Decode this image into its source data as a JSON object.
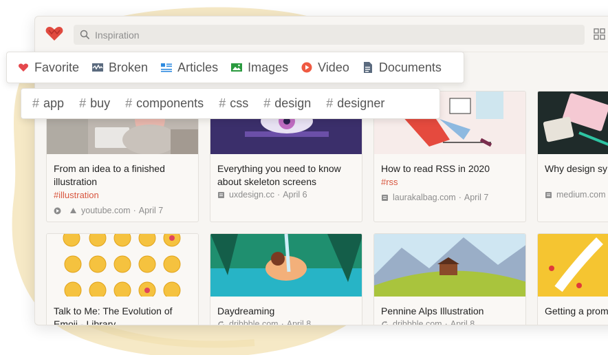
{
  "search": {
    "placeholder": "Inspiration",
    "value": ""
  },
  "types": [
    {
      "label": "Favorite",
      "icon": "heart-icon",
      "color": "#e5484d"
    },
    {
      "label": "Broken",
      "icon": "broken-link-icon",
      "color": "#5a6a7e"
    },
    {
      "label": "Articles",
      "icon": "articles-icon",
      "color": "#2f8be0"
    },
    {
      "label": "Images",
      "icon": "image-icon",
      "color": "#2a9a3f"
    },
    {
      "label": "Video",
      "icon": "video-icon",
      "color": "#ef5a42"
    },
    {
      "label": "Documents",
      "icon": "document-icon",
      "color": "#5a6a7e"
    }
  ],
  "tags": [
    {
      "hash": "#",
      "label": "app"
    },
    {
      "hash": "#",
      "label": "buy"
    },
    {
      "hash": "#",
      "label": "components"
    },
    {
      "hash": "#",
      "label": "css"
    },
    {
      "hash": "#",
      "label": "design"
    },
    {
      "hash": "#",
      "label": "designer"
    }
  ],
  "cards": [
    {
      "title": "From an idea to a finished illustration",
      "tag": "#illustration",
      "type_icon": "video-icon",
      "source_icon": "youtube-favicon",
      "source": "youtube.com",
      "date": "April 7"
    },
    {
      "title": "Everything you need to know about skeleton screens",
      "tag": "",
      "source_icon": "article-favicon",
      "source": "uxdesign.cc",
      "date": "April 6"
    },
    {
      "title": "How to read RSS in 2020",
      "tag": "#rss",
      "source_icon": "article-favicon",
      "source": "laurakalbag.com",
      "date": "April 7"
    },
    {
      "title": "Why design sy product design",
      "tag": "",
      "source_icon": "article-favicon",
      "source": "medium.com",
      "date": "A"
    },
    {
      "title": "Talk to Me: The Evolution of Emoji - Library",
      "tag": "",
      "source_icon": "",
      "source": "",
      "date": ""
    },
    {
      "title": "Daydreaming",
      "tag": "",
      "source_icon": "dribbble-favicon",
      "source": "dribbble.com",
      "date": "April 8"
    },
    {
      "title": "Pennine Alps Illustration",
      "tag": "",
      "source_icon": "dribbble-favicon",
      "source": "dribbble.com",
      "date": "April 8"
    },
    {
      "title": "Getting a prom same as being",
      "tag": "",
      "source_icon": "",
      "source": "",
      "date": ""
    }
  ],
  "date_separator": "·",
  "colors": {
    "accent": "#d8563f",
    "brand": "#e04a3f",
    "blob": "#f6e9c6"
  }
}
